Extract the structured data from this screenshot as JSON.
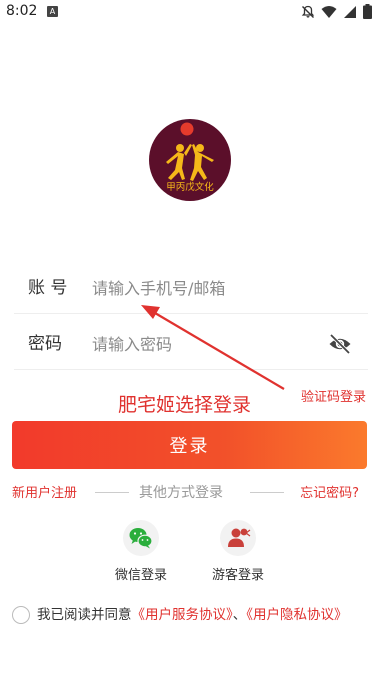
{
  "status_bar": {
    "time": "8:02",
    "a_badge": "A"
  },
  "logo": {
    "text": "甲丙戊文化",
    "colors": {
      "circle": "#5b0f2a",
      "figures": "#f5b819",
      "ball": "#e53b2c"
    }
  },
  "form": {
    "account": {
      "label": "账 号",
      "placeholder": "请输入手机号/邮箱",
      "value": ""
    },
    "password": {
      "label": "密码",
      "placeholder": "请输入密码",
      "value": ""
    }
  },
  "verify_code_login": "验证码登录",
  "caption": "肥宅姬选择登录",
  "login_button": "登录",
  "links": {
    "register": "新用户注册",
    "other_methods": "其他方式登录",
    "forgot": "忘记密码?"
  },
  "social": [
    {
      "label": "微信登录",
      "icon": "wechat-icon"
    },
    {
      "label": "游客登录",
      "icon": "guest-icon"
    }
  ],
  "agreement": {
    "prefix": "我已阅读并同意",
    "service": "《用户服务协议》",
    "separator": "、",
    "privacy": "《用户隐私协议》"
  },
  "colors": {
    "accent": "#e0322f",
    "button_start": "#f23a2b",
    "button_end": "#fb7a2c",
    "wechat": "#2aae3c",
    "guest": "#c9403a"
  }
}
